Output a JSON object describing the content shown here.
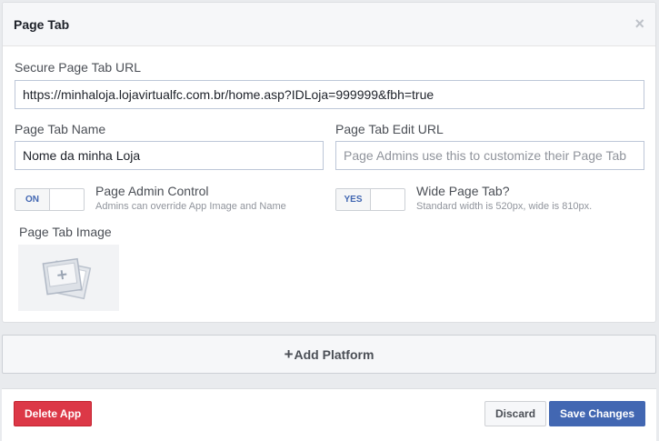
{
  "dialog": {
    "title": "Page Tab",
    "close_glyph": "×"
  },
  "fields": {
    "secure_url": {
      "label": "Secure Page Tab URL",
      "value": "https://minhaloja.lojavirtualfc.com.br/home.asp?IDLoja=999999&fbh=true"
    },
    "tab_name": {
      "label": "Page Tab Name",
      "value": "Nome da minha Loja"
    },
    "edit_url": {
      "label": "Page Tab Edit URL",
      "value": "",
      "placeholder": "Page Admins use this to customize their Page Tab"
    }
  },
  "toggles": {
    "admin_control": {
      "state_label": "ON",
      "title": "Page Admin Control",
      "description": "Admins can override App Image and Name"
    },
    "wide_tab": {
      "state_label": "YES",
      "title": "Wide Page Tab?",
      "description": "Standard width is 520px, wide is 810px."
    }
  },
  "image": {
    "label": "Page Tab Image",
    "icon": "image-placeholder-icon"
  },
  "add_platform": {
    "plus": "+",
    "label": "Add Platform"
  },
  "footer": {
    "delete_label": "Delete App",
    "discard_label": "Discard",
    "save_label": "Save Changes"
  },
  "colors": {
    "primary_blue": "#4267b2",
    "danger_red": "#dc3847",
    "background": "#e9ebee"
  }
}
